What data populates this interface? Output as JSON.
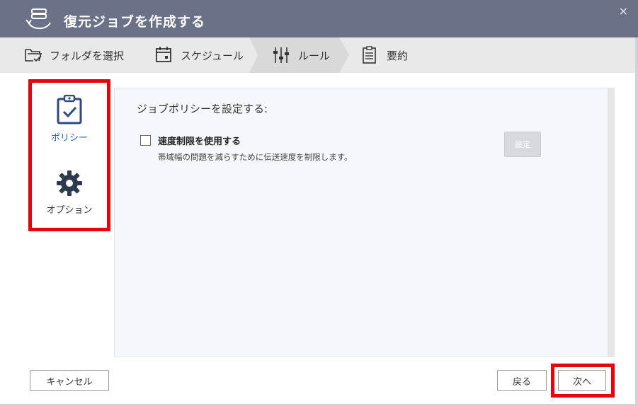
{
  "window": {
    "title": "復元ジョブを作成する",
    "close_glyph": "×"
  },
  "steps": [
    {
      "label": "フォルダを選択",
      "icon": "folder-check-icon"
    },
    {
      "label": "スケジュール",
      "icon": "calendar-icon"
    },
    {
      "label": "ルール",
      "icon": "sliders-icon",
      "active": true
    },
    {
      "label": "要約",
      "icon": "clipboard-list-icon"
    }
  ],
  "nav": {
    "items": [
      {
        "label": "ポリシー",
        "icon": "clipboard-check-icon",
        "selected": true
      },
      {
        "label": "オプション",
        "icon": "gear-icon"
      }
    ]
  },
  "content": {
    "heading": "ジョブポリシーを設定する:",
    "speed_limit": {
      "label": "速度制限を使用する",
      "description": "帯域幅の問題を減らすために伝送速度を制限します。",
      "checked": false,
      "set_button": "設定"
    }
  },
  "footer": {
    "cancel": "キャンセル",
    "back": "戻る",
    "next": "次へ"
  },
  "colors": {
    "titlebar": "#6b7288",
    "highlight": "#e8000b",
    "accent": "#2d62c2"
  }
}
